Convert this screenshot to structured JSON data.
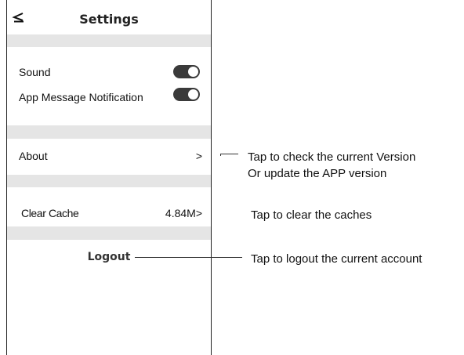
{
  "header": {
    "title": "Settings",
    "back_icon": "back-arrow-icon"
  },
  "sound": {
    "label": "Sound",
    "enabled": true
  },
  "notification": {
    "label": "App Message Notification",
    "enabled": true
  },
  "about": {
    "label": "About",
    "value": ">"
  },
  "cache": {
    "label": "Clear Cache",
    "value": "4.84M>"
  },
  "logout": {
    "label": "Logout"
  },
  "annotations": {
    "about_line1": "Tap to check the current Version",
    "about_line2": "Or update the APP version",
    "cache": "Tap to clear the caches",
    "logout": "Tap to logout the current account"
  },
  "colors": {
    "toggle_on": "#3a3a3a",
    "section_gap": "#e5e5e5"
  }
}
